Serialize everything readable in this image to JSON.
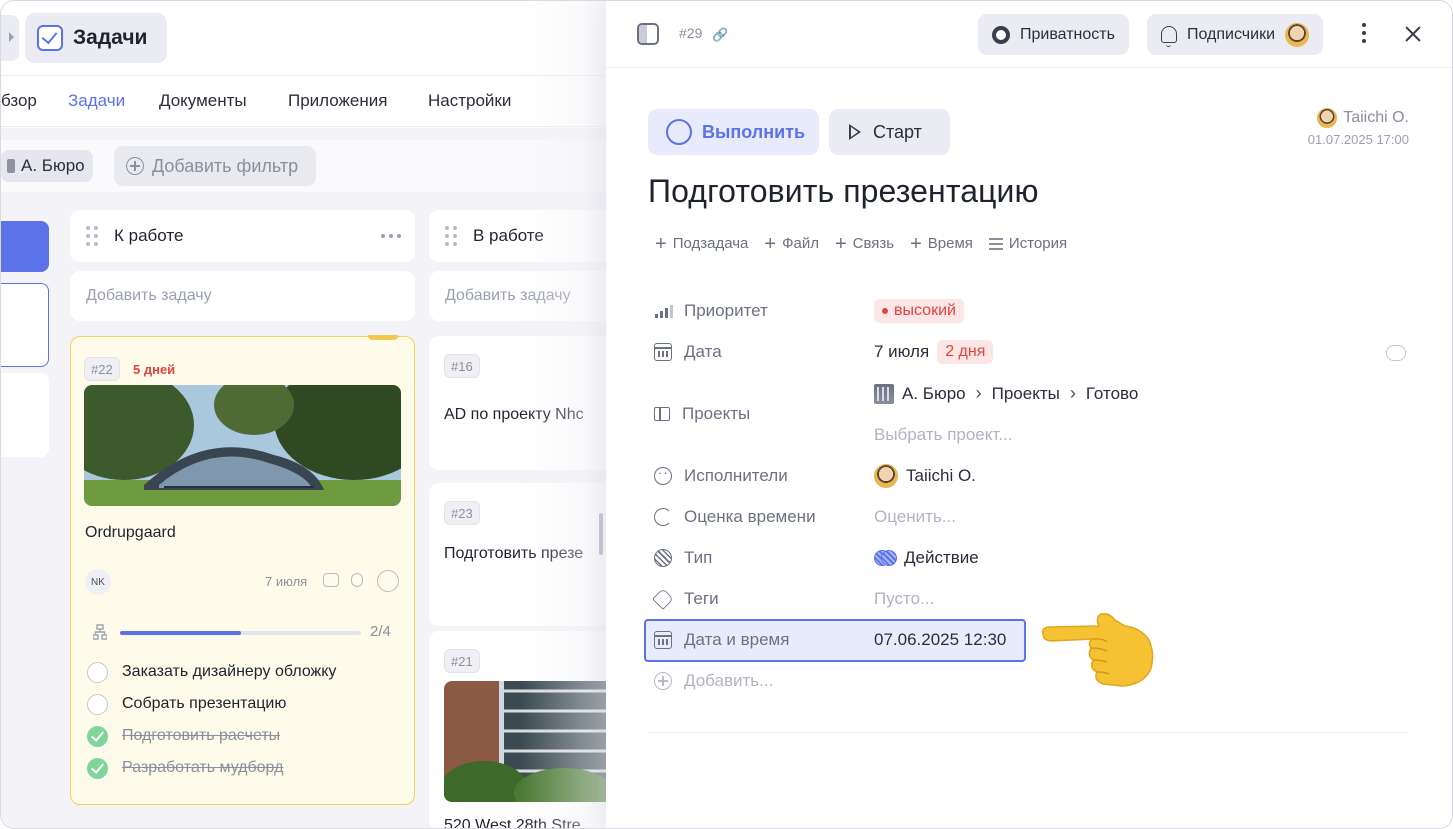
{
  "app": {
    "title": "Задачи"
  },
  "nav_tabs": [
    {
      "label": "бзор"
    },
    {
      "label": "Задачи",
      "active": true
    },
    {
      "label": "Документы"
    },
    {
      "label": "Приложения"
    },
    {
      "label": "Настройки"
    }
  ],
  "filters": {
    "chip": "А. Бюро",
    "add": "Добавить фильтр"
  },
  "columns": [
    {
      "title": "К работе",
      "add_task": "Добавить задачу"
    },
    {
      "title": "В работе",
      "add_task": "Добавить задачу"
    }
  ],
  "main_card": {
    "id": "#22",
    "due": "5 дней",
    "title": "Ordrupgaard",
    "assignee_initials": "NK",
    "date": "7 июля",
    "progress": {
      "label": "2/4",
      "fraction": 0.5
    },
    "checklist": [
      {
        "text": "Заказать дизайнеру обложку",
        "done": false
      },
      {
        "text": "Собрать презентацию",
        "done": false
      },
      {
        "text": "Подготовить расчеты",
        "done": true
      },
      {
        "text": "Разработать мудборд",
        "done": true
      }
    ]
  },
  "right_cards": [
    {
      "id": "#16",
      "title": "AD по проекту Nhc"
    },
    {
      "id": "#23",
      "title": "Подготовить презе"
    },
    {
      "id": "#21",
      "title": "520 West 28th Stre"
    }
  ],
  "panel": {
    "task_number": "#29",
    "privacy_label": "Приватность",
    "subscribers_label": "Подписчики",
    "complete_label": "Выполнить",
    "start_label": "Старт",
    "author": {
      "name": "Taiichi O.",
      "date": "01.07.2025 17:00"
    },
    "title": "Подготовить презентацию",
    "actions": [
      "Подзадача",
      "Файл",
      "Связь",
      "Время",
      "История"
    ],
    "properties": {
      "priority": {
        "label": "Приоритет",
        "value": "высокий"
      },
      "date": {
        "label": "Дата",
        "value": "7 июля",
        "badge": "2 дня"
      },
      "projects": {
        "label": "Проекты",
        "path": [
          "А. Бюро",
          "Проекты",
          "Готово"
        ],
        "placeholder": "Выбрать проект..."
      },
      "assignees": {
        "label": "Исполнители",
        "value": "Taiichi O."
      },
      "estimate": {
        "label": "Оценка времени",
        "placeholder": "Оценить..."
      },
      "type": {
        "label": "Тип",
        "value": "Действие"
      },
      "tags": {
        "label": "Теги",
        "placeholder": "Пусто..."
      },
      "datetime": {
        "label": "Дата и время",
        "value": "07.06.2025 12:30"
      },
      "add": {
        "label": "Добавить..."
      }
    }
  },
  "colors": {
    "accent": "#5b72e8",
    "danger": "#e0443e",
    "card_highlight": "#fffbea",
    "success": "#7fd69a"
  }
}
